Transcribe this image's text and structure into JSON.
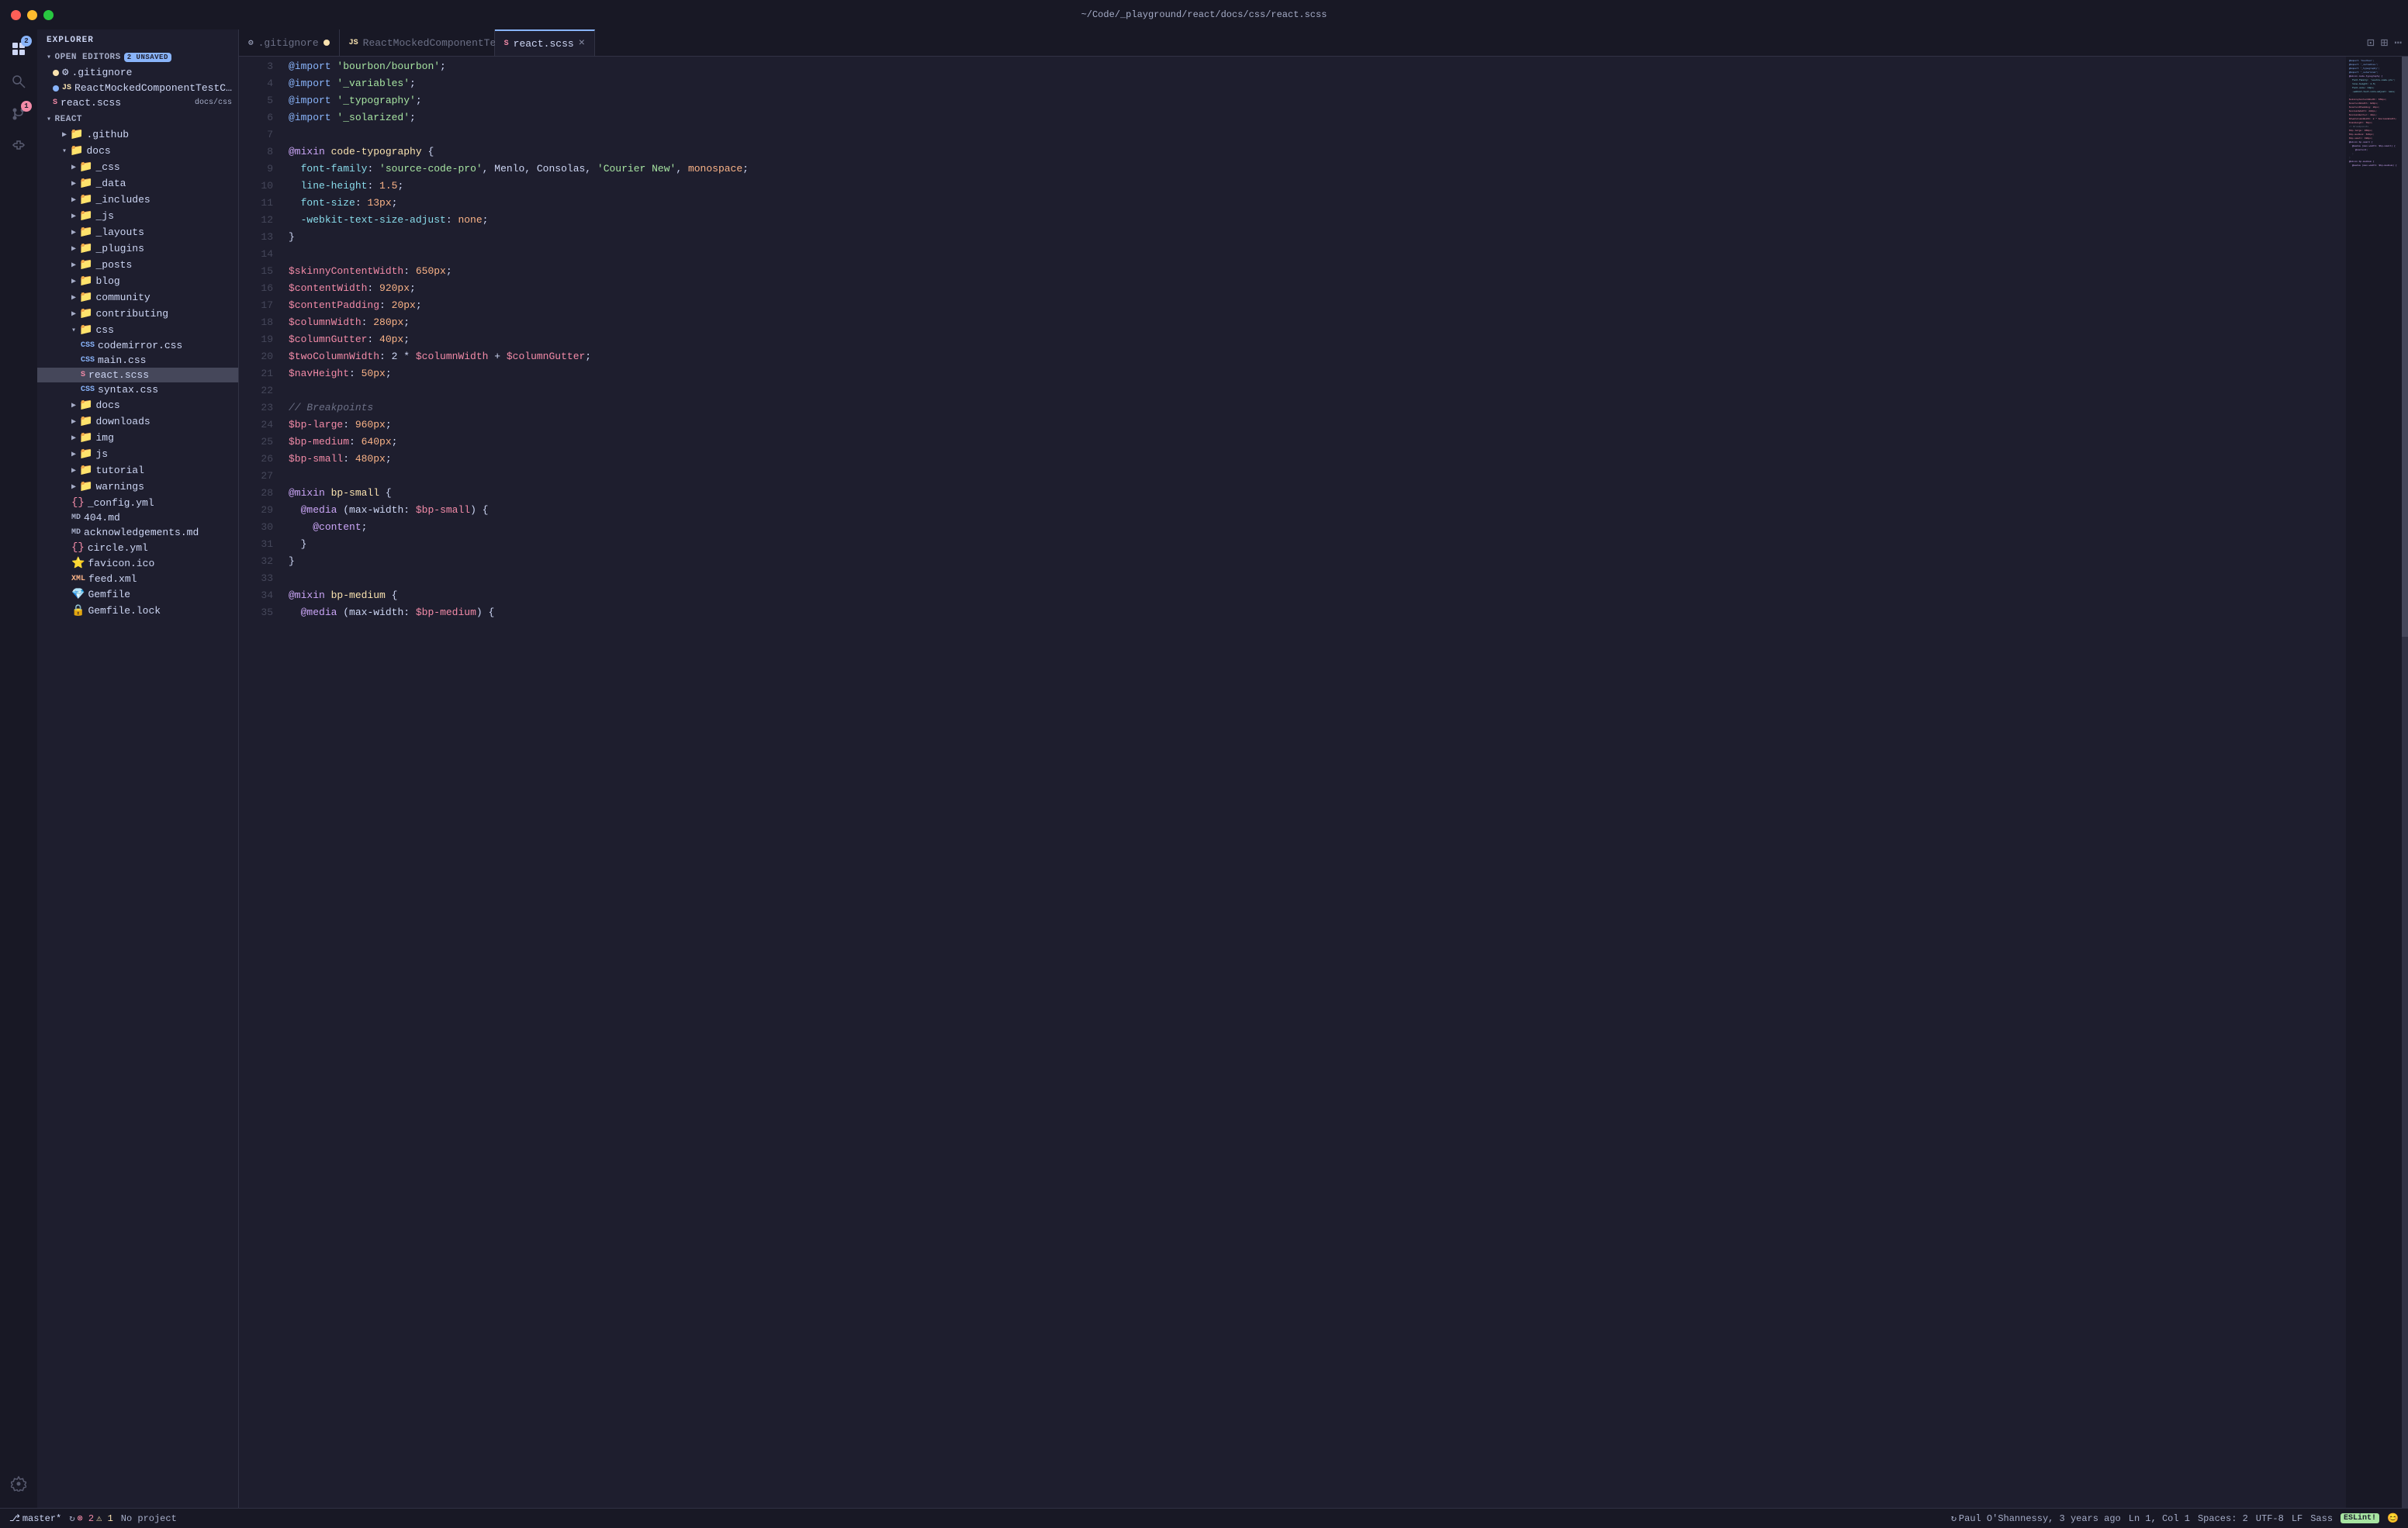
{
  "titlebar": {
    "title": "~/Code/_playground/react/docs/css/react.scss"
  },
  "tabs": [
    {
      "id": "gitignore",
      "label": ".gitignore",
      "icon": "⚙",
      "modified": true,
      "active": false
    },
    {
      "id": "ReactMockedComponentTestComponent",
      "label": "ReactMockedComponentTestComponent.js",
      "icon": "JS",
      "modified": true,
      "active": false
    },
    {
      "id": "react.scss",
      "label": "react.scss",
      "icon": "SCSS",
      "modified": false,
      "active": true
    }
  ],
  "sidebar": {
    "explorer_label": "EXPLORER",
    "open_editors_label": "OPEN EDITORS",
    "unsaved_badge": "2 UNSAVED",
    "react_label": "REACT",
    "open_files": [
      {
        "name": ".gitignore",
        "icon": "⚙",
        "color": "#a6adc8",
        "modified": true
      },
      {
        "name": "ReactMockedComponentTestComp...",
        "icon": "JS",
        "color": "#f9e2af",
        "modified": true
      },
      {
        "name": "react.scss",
        "icon": "SCSS",
        "color": "#f38ba8",
        "badge": "docs/css"
      }
    ],
    "tree": [
      {
        "name": ".github",
        "icon": "📁",
        "indent": 1,
        "type": "folder",
        "open": false
      },
      {
        "name": "docs",
        "icon": "📁",
        "indent": 1,
        "type": "folder",
        "open": true,
        "color": "#89b4fa"
      },
      {
        "name": "_css",
        "icon": "📁",
        "indent": 2,
        "type": "folder",
        "open": false
      },
      {
        "name": "_data",
        "icon": "📁",
        "indent": 2,
        "type": "folder",
        "open": false
      },
      {
        "name": "_includes",
        "icon": "📁",
        "indent": 2,
        "type": "folder",
        "open": false
      },
      {
        "name": "_js",
        "icon": "📁",
        "indent": 2,
        "type": "folder",
        "open": false
      },
      {
        "name": "_layouts",
        "icon": "📁",
        "indent": 2,
        "type": "folder",
        "open": false
      },
      {
        "name": "_plugins",
        "icon": "📁",
        "indent": 2,
        "type": "folder",
        "open": false
      },
      {
        "name": "_posts",
        "icon": "📁",
        "indent": 2,
        "type": "folder",
        "open": false
      },
      {
        "name": "blog",
        "icon": "📁",
        "indent": 2,
        "type": "folder",
        "open": false
      },
      {
        "name": "community",
        "icon": "📁",
        "indent": 2,
        "type": "folder",
        "open": false
      },
      {
        "name": "contributing",
        "icon": "📁",
        "indent": 2,
        "type": "folder",
        "open": false
      },
      {
        "name": "css",
        "icon": "📁",
        "indent": 2,
        "type": "folder",
        "open": true,
        "color": "#89b4fa"
      },
      {
        "name": "codemirror.css",
        "icon": "CSS",
        "indent": 3,
        "type": "file"
      },
      {
        "name": "main.css",
        "icon": "CSS",
        "indent": 3,
        "type": "file"
      },
      {
        "name": "react.scss",
        "icon": "SCSS",
        "indent": 3,
        "type": "file",
        "selected": true
      },
      {
        "name": "syntax.css",
        "icon": "CSS",
        "indent": 3,
        "type": "file"
      },
      {
        "name": "docs",
        "icon": "📁",
        "indent": 2,
        "type": "folder",
        "open": false,
        "color": "#89b4fa"
      },
      {
        "name": "downloads",
        "icon": "📁",
        "indent": 2,
        "type": "folder",
        "open": false
      },
      {
        "name": "img",
        "icon": "📁",
        "indent": 2,
        "type": "folder",
        "open": false,
        "color": "#89b4fa"
      },
      {
        "name": "js",
        "icon": "📁",
        "indent": 2,
        "type": "folder",
        "open": false
      },
      {
        "name": "tutorial",
        "icon": "📁",
        "indent": 2,
        "type": "folder",
        "open": false
      },
      {
        "name": "warnings",
        "icon": "📁",
        "indent": 2,
        "type": "folder",
        "open": false
      },
      {
        "name": "_config.yml",
        "icon": "{}",
        "indent": 2,
        "type": "file",
        "color": "#f38ba8"
      },
      {
        "name": "404.md",
        "icon": "MD",
        "indent": 2,
        "type": "file"
      },
      {
        "name": "acknowledgements.md",
        "icon": "MD",
        "indent": 2,
        "type": "file"
      },
      {
        "name": "circle.yml",
        "icon": "{}",
        "indent": 2,
        "type": "file",
        "color": "#f38ba8"
      },
      {
        "name": "favicon.ico",
        "icon": "⭐",
        "indent": 2,
        "type": "file"
      },
      {
        "name": "feed.xml",
        "icon": "XML",
        "indent": 2,
        "type": "file",
        "color": "#fab387"
      },
      {
        "name": "Gemfile",
        "icon": "💎",
        "indent": 2,
        "type": "file",
        "color": "#a6e3a1"
      },
      {
        "name": "Gemfile.lock",
        "icon": "🔒",
        "indent": 2,
        "type": "file"
      }
    ]
  },
  "editor": {
    "lines": [
      {
        "num": 3,
        "tokens": [
          {
            "t": "@import",
            "c": "at"
          },
          {
            "t": " ",
            "c": ""
          },
          {
            "t": "'bourbon/bourbon'",
            "c": "str"
          },
          {
            "t": ";",
            "c": "punc"
          }
        ]
      },
      {
        "num": 4,
        "tokens": [
          {
            "t": "@import",
            "c": "at"
          },
          {
            "t": " ",
            "c": ""
          },
          {
            "t": "'_variables'",
            "c": "str"
          },
          {
            "t": ";",
            "c": "punc"
          }
        ]
      },
      {
        "num": 5,
        "tokens": [
          {
            "t": "@import",
            "c": "at"
          },
          {
            "t": " ",
            "c": ""
          },
          {
            "t": "'_typography'",
            "c": "str"
          },
          {
            "t": ";",
            "c": "punc"
          }
        ]
      },
      {
        "num": 6,
        "tokens": [
          {
            "t": "@import",
            "c": "at"
          },
          {
            "t": " ",
            "c": ""
          },
          {
            "t": "'_solarized'",
            "c": "str"
          },
          {
            "t": ";",
            "c": "punc"
          }
        ]
      },
      {
        "num": 7,
        "tokens": [
          {
            "t": "",
            "c": ""
          }
        ]
      },
      {
        "num": 8,
        "tokens": [
          {
            "t": "@mixin",
            "c": "kw"
          },
          {
            "t": " ",
            "c": ""
          },
          {
            "t": "code-typography",
            "c": "cls"
          },
          {
            "t": " {",
            "c": "punc"
          }
        ]
      },
      {
        "num": 9,
        "tokens": [
          {
            "t": "  font-family",
            "c": "prop"
          },
          {
            "t": ": ",
            "c": "punc"
          },
          {
            "t": "'source-code-pro'",
            "c": "str"
          },
          {
            "t": ", Menlo, Consolas, ",
            "c": ""
          },
          {
            "t": "'Courier New'",
            "c": "str"
          },
          {
            "t": ", ",
            "c": ""
          },
          {
            "t": "monospace",
            "c": "val"
          },
          {
            "t": ";",
            "c": "punc"
          }
        ]
      },
      {
        "num": 10,
        "tokens": [
          {
            "t": "  line-height",
            "c": "prop"
          },
          {
            "t": ": ",
            "c": "punc"
          },
          {
            "t": "1.5",
            "c": "num"
          },
          {
            "t": ";",
            "c": "punc"
          }
        ]
      },
      {
        "num": 11,
        "tokens": [
          {
            "t": "  font-size",
            "c": "prop"
          },
          {
            "t": ": ",
            "c": "punc"
          },
          {
            "t": "13px",
            "c": "num"
          },
          {
            "t": ";",
            "c": "punc"
          }
        ]
      },
      {
        "num": 12,
        "tokens": [
          {
            "t": "  -webkit-text-size-adjust",
            "c": "prop"
          },
          {
            "t": ": ",
            "c": "punc"
          },
          {
            "t": "none",
            "c": "val"
          },
          {
            "t": ";",
            "c": "punc"
          }
        ]
      },
      {
        "num": 13,
        "tokens": [
          {
            "t": "}",
            "c": "punc"
          }
        ]
      },
      {
        "num": 14,
        "tokens": [
          {
            "t": "",
            "c": ""
          }
        ]
      },
      {
        "num": 15,
        "tokens": [
          {
            "t": "$skinnyContentWidth",
            "c": "var"
          },
          {
            "t": ": ",
            "c": "punc"
          },
          {
            "t": "650px",
            "c": "num"
          },
          {
            "t": ";",
            "c": "punc"
          }
        ]
      },
      {
        "num": 16,
        "tokens": [
          {
            "t": "$contentWidth",
            "c": "var"
          },
          {
            "t": ": ",
            "c": "punc"
          },
          {
            "t": "920px",
            "c": "num"
          },
          {
            "t": ";",
            "c": "punc"
          }
        ]
      },
      {
        "num": 17,
        "tokens": [
          {
            "t": "$contentPadding",
            "c": "var"
          },
          {
            "t": ": ",
            "c": "punc"
          },
          {
            "t": "20px",
            "c": "num"
          },
          {
            "t": ";",
            "c": "punc"
          }
        ]
      },
      {
        "num": 18,
        "tokens": [
          {
            "t": "$columnWidth",
            "c": "var"
          },
          {
            "t": ": ",
            "c": "punc"
          },
          {
            "t": "280px",
            "c": "num"
          },
          {
            "t": ";",
            "c": "punc"
          }
        ]
      },
      {
        "num": 19,
        "tokens": [
          {
            "t": "$columnGutter",
            "c": "var"
          },
          {
            "t": ": ",
            "c": "punc"
          },
          {
            "t": "40px",
            "c": "num"
          },
          {
            "t": ";",
            "c": "punc"
          }
        ]
      },
      {
        "num": 20,
        "tokens": [
          {
            "t": "$twoColumnWidth",
            "c": "var"
          },
          {
            "t": ": 2 * ",
            "c": "punc"
          },
          {
            "t": "$columnWidth",
            "c": "var"
          },
          {
            "t": " + ",
            "c": "punc"
          },
          {
            "t": "$columnGutter",
            "c": "var"
          },
          {
            "t": ";",
            "c": "punc"
          }
        ]
      },
      {
        "num": 21,
        "tokens": [
          {
            "t": "$navHeight",
            "c": "var"
          },
          {
            "t": ": ",
            "c": "punc"
          },
          {
            "t": "50px",
            "c": "num"
          },
          {
            "t": ";",
            "c": "punc"
          }
        ]
      },
      {
        "num": 22,
        "tokens": [
          {
            "t": "",
            "c": ""
          }
        ]
      },
      {
        "num": 23,
        "tokens": [
          {
            "t": "// Breakpoints",
            "c": "comment"
          }
        ]
      },
      {
        "num": 24,
        "tokens": [
          {
            "t": "$bp-large",
            "c": "var"
          },
          {
            "t": ": ",
            "c": "punc"
          },
          {
            "t": "960px",
            "c": "num"
          },
          {
            "t": ";",
            "c": "punc"
          }
        ]
      },
      {
        "num": 25,
        "tokens": [
          {
            "t": "$bp-medium",
            "c": "var"
          },
          {
            "t": ": ",
            "c": "punc"
          },
          {
            "t": "640px",
            "c": "num"
          },
          {
            "t": ";",
            "c": "punc"
          }
        ]
      },
      {
        "num": 26,
        "tokens": [
          {
            "t": "$bp-small",
            "c": "var"
          },
          {
            "t": ": ",
            "c": "punc"
          },
          {
            "t": "480px",
            "c": "num"
          },
          {
            "t": ";",
            "c": "punc"
          }
        ]
      },
      {
        "num": 27,
        "tokens": [
          {
            "t": "",
            "c": ""
          }
        ]
      },
      {
        "num": 28,
        "tokens": [
          {
            "t": "@mixin",
            "c": "kw"
          },
          {
            "t": " ",
            "c": ""
          },
          {
            "t": "bp-small",
            "c": "cls"
          },
          {
            "t": " {",
            "c": "punc"
          }
        ]
      },
      {
        "num": 29,
        "tokens": [
          {
            "t": "  @media",
            "c": "kw"
          },
          {
            "t": " (max-width: ",
            "c": "punc"
          },
          {
            "t": "$bp-small",
            "c": "var"
          },
          {
            "t": ") {",
            "c": "punc"
          }
        ]
      },
      {
        "num": 30,
        "tokens": [
          {
            "t": "    @content",
            "c": "kw"
          },
          {
            "t": ";",
            "c": "punc"
          }
        ]
      },
      {
        "num": 31,
        "tokens": [
          {
            "t": "  }",
            "c": "punc"
          }
        ]
      },
      {
        "num": 32,
        "tokens": [
          {
            "t": "}",
            "c": "punc"
          }
        ]
      },
      {
        "num": 33,
        "tokens": [
          {
            "t": "",
            "c": ""
          }
        ]
      },
      {
        "num": 34,
        "tokens": [
          {
            "t": "@mixin",
            "c": "kw"
          },
          {
            "t": " ",
            "c": ""
          },
          {
            "t": "bp-medium",
            "c": "cls"
          },
          {
            "t": " {",
            "c": "punc"
          }
        ]
      },
      {
        "num": 35,
        "tokens": [
          {
            "t": "  @media",
            "c": "kw"
          },
          {
            "t": " (max-width: ",
            "c": "punc"
          },
          {
            "t": "$bp-medium",
            "c": "var"
          },
          {
            "t": ") {",
            "c": "punc"
          }
        ]
      }
    ]
  },
  "status_bar": {
    "branch": "master*",
    "sync_icon": "↻",
    "errors": "2",
    "warnings": "1",
    "no_project": "No project",
    "git_blame": "Paul O'Shannessy, 3 years ago",
    "position": "Ln 1, Col 1",
    "spaces": "Spaces: 2",
    "encoding": "UTF-8",
    "line_ending": "LF",
    "language": "Sass",
    "eslint": "ESLint!"
  }
}
